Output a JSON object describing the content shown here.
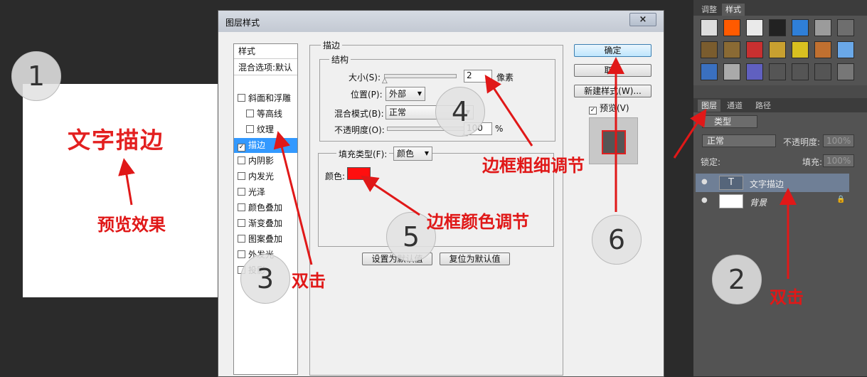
{
  "preview": {
    "text": "文字描边"
  },
  "annotations": {
    "preview_label": "预览效果",
    "double_click_1": "双击",
    "double_click_2": "双击",
    "thickness": "边框粗细调节",
    "color": "边框颜色调节",
    "n1": "1",
    "n2": "2",
    "n3": "3",
    "n4": "4",
    "n5": "5",
    "n6": "6",
    "color_hex": "#e01818"
  },
  "dialog": {
    "title": "图层样式",
    "close": "×",
    "list": {
      "header": "样式",
      "blend": "混合选项:默认",
      "items": [
        {
          "label": "斜面和浮雕",
          "checked": false,
          "indent": false
        },
        {
          "label": "等高线",
          "checked": false,
          "indent": true
        },
        {
          "label": "纹理",
          "checked": false,
          "indent": true
        },
        {
          "label": "描边",
          "checked": true,
          "indent": false
        },
        {
          "label": "内阴影",
          "checked": false,
          "indent": false
        },
        {
          "label": "内发光",
          "checked": false,
          "indent": false
        },
        {
          "label": "光泽",
          "checked": false,
          "indent": false
        },
        {
          "label": "颜色叠加",
          "checked": false,
          "indent": false
        },
        {
          "label": "渐变叠加",
          "checked": false,
          "indent": false
        },
        {
          "label": "图案叠加",
          "checked": false,
          "indent": false
        },
        {
          "label": "外发光",
          "checked": false,
          "indent": false
        },
        {
          "label": "投影",
          "checked": false,
          "indent": false
        }
      ]
    },
    "stroke": {
      "group_title": "描边",
      "structure_title": "结构",
      "size_label": "大小(S):",
      "size_value": "2",
      "size_unit": "像素",
      "size_slider": 0.01,
      "position_label": "位置(P):",
      "position_value": "外部",
      "blend_label": "混合模式(B):",
      "blend_value": "正常",
      "opacity_label": "不透明度(O):",
      "opacity_value": "100",
      "opacity_unit": "%",
      "opacity_slider": 1.0,
      "fill_type_label": "填充类型(F):",
      "fill_type_value": "颜色",
      "color_label": "颜色:",
      "color_value": "#ff0f0f"
    },
    "buttons": {
      "set_default": "设置为默认值",
      "reset_default": "复位为默认值",
      "ok": "确定",
      "cancel": "取消",
      "new_style": "新建样式(W)...",
      "preview_label": "预览(V)",
      "preview_checked": true
    }
  },
  "panel": {
    "styles_tabs": [
      "调整",
      "样式"
    ],
    "layers_tabs": [
      "图层",
      "通道",
      "路径"
    ],
    "filter_label": "类型",
    "blend_mode": "正常",
    "opacity_label": "不透明度:",
    "opacity_value": "100%",
    "lock_label": "锁定:",
    "fill_label": "填充:",
    "fill_value": "100%",
    "layers": [
      {
        "name": "文字描边",
        "type": "text",
        "selected": true,
        "thumb": "T"
      },
      {
        "name": "背景",
        "type": "background",
        "selected": false,
        "thumb": ""
      }
    ]
  }
}
